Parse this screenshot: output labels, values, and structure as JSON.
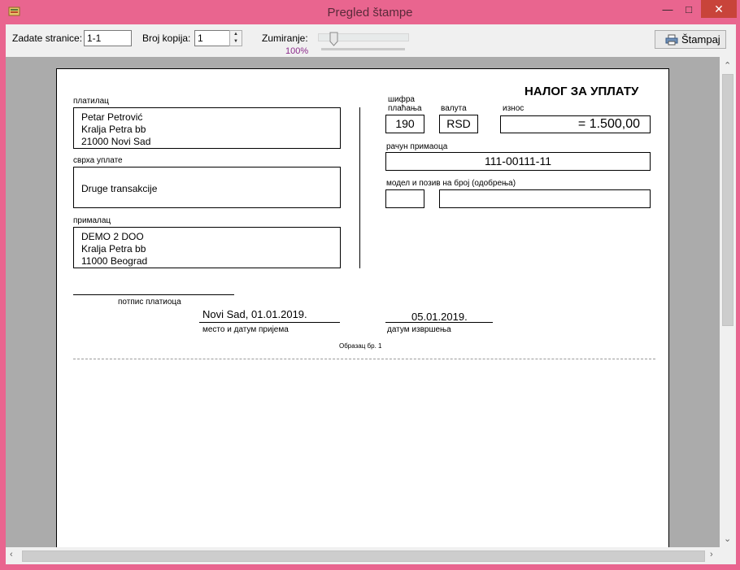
{
  "window": {
    "title": "Pregled štampe"
  },
  "toolbar": {
    "pages_label": "Zadate stranice:",
    "pages_value": "1-1",
    "copies_label": "Broj kopija:",
    "copies_value": "1",
    "zoom_label": "Zumiranje:",
    "zoom_value": "100%",
    "print_label": "Štampaj"
  },
  "form": {
    "title": "НАЛОГ ЗА УПЛАТУ",
    "payer_label": "платилац",
    "payer_lines": [
      "Petar Petrović",
      "Kralja Petra bb",
      "21000 Novi Sad"
    ],
    "purpose_label": "сврха уплате",
    "purpose": "Druge transakcije",
    "recipient_label": "прималац",
    "recipient_lines": [
      "DEMO 2 DOO",
      "Kralja Petra bb",
      "11000 Beograd"
    ],
    "payment_code_label_1": "шифра",
    "payment_code_label_2": "плаћања",
    "payment_code": "190",
    "currency_label": "валута",
    "currency": "RSD",
    "amount_label": "износ",
    "amount": "= 1.500,00",
    "account_label": "рачун примаоца",
    "account": "111-00111-11",
    "model_label": "модел и позив на број (одобрења)",
    "signature_label": "потпис платиоца",
    "place_date": "Novi Sad, 01.01.2019.",
    "place_date_label": "место и датум пријема",
    "exec_date": "05.01.2019.",
    "exec_date_label": "датум извршења",
    "form_number": "Образац бр. 1"
  }
}
